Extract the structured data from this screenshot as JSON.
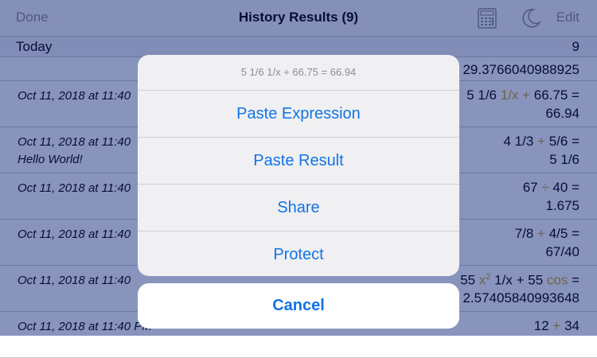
{
  "navbar": {
    "done_label": "Done",
    "title": "History Results (9)",
    "edit_label": "Edit",
    "calculator_icon": "calculator-icon",
    "moon_icon": "moon-icon"
  },
  "section": {
    "label": "Today",
    "count": "9"
  },
  "rows": [
    {
      "date": "",
      "note": "",
      "expr_main": "",
      "result": "29.3766040988925"
    },
    {
      "date": "Oct 11, 2018 at 11:40",
      "note": "",
      "expr_a": "5 1/6 ",
      "expr_op": "1/x + ",
      "expr_b": "66.75 =",
      "result": "66.94"
    },
    {
      "date": "Oct 11, 2018 at 11:40",
      "note": "Hello World!",
      "expr_a": "4 1/3 ",
      "expr_op": "+",
      "expr_b": " 5/6 =",
      "result": "5 1/6"
    },
    {
      "date": "Oct 11, 2018 at 11:40",
      "note": "",
      "expr_a": "67 ",
      "expr_op": "÷",
      "expr_b": " 40 =",
      "result": "1.675"
    },
    {
      "date": "Oct 11, 2018 at 11:40",
      "note": "",
      "expr_a": "7/8 ",
      "expr_op": "+",
      "expr_b": " 4/5 =",
      "result": "67/40"
    },
    {
      "date": "Oct 11, 2018 at 11:40",
      "note": "",
      "expr_a": "55 ",
      "expr_op": "x",
      "expr_sup": "2",
      "expr_op2": " 1/x +",
      "expr_b": " 55 ",
      "expr_op3": "cos",
      "expr_c": " =",
      "result": "2.57405840993648"
    },
    {
      "date": "Oct 11, 2018 at 11:40 PM",
      "note": "",
      "expr_a": "12 ",
      "expr_op": "+",
      "expr_b": " 34",
      "result": ""
    }
  ],
  "sheet": {
    "message": "5 1/6 1/x + 66.75 = 66.94",
    "actions": [
      "Paste Expression",
      "Paste Result",
      "Share",
      "Protect"
    ],
    "cancel_label": "Cancel"
  },
  "colors": {
    "accent": "#1273e6",
    "operator": "#c9a227",
    "overlay": "#082076"
  }
}
